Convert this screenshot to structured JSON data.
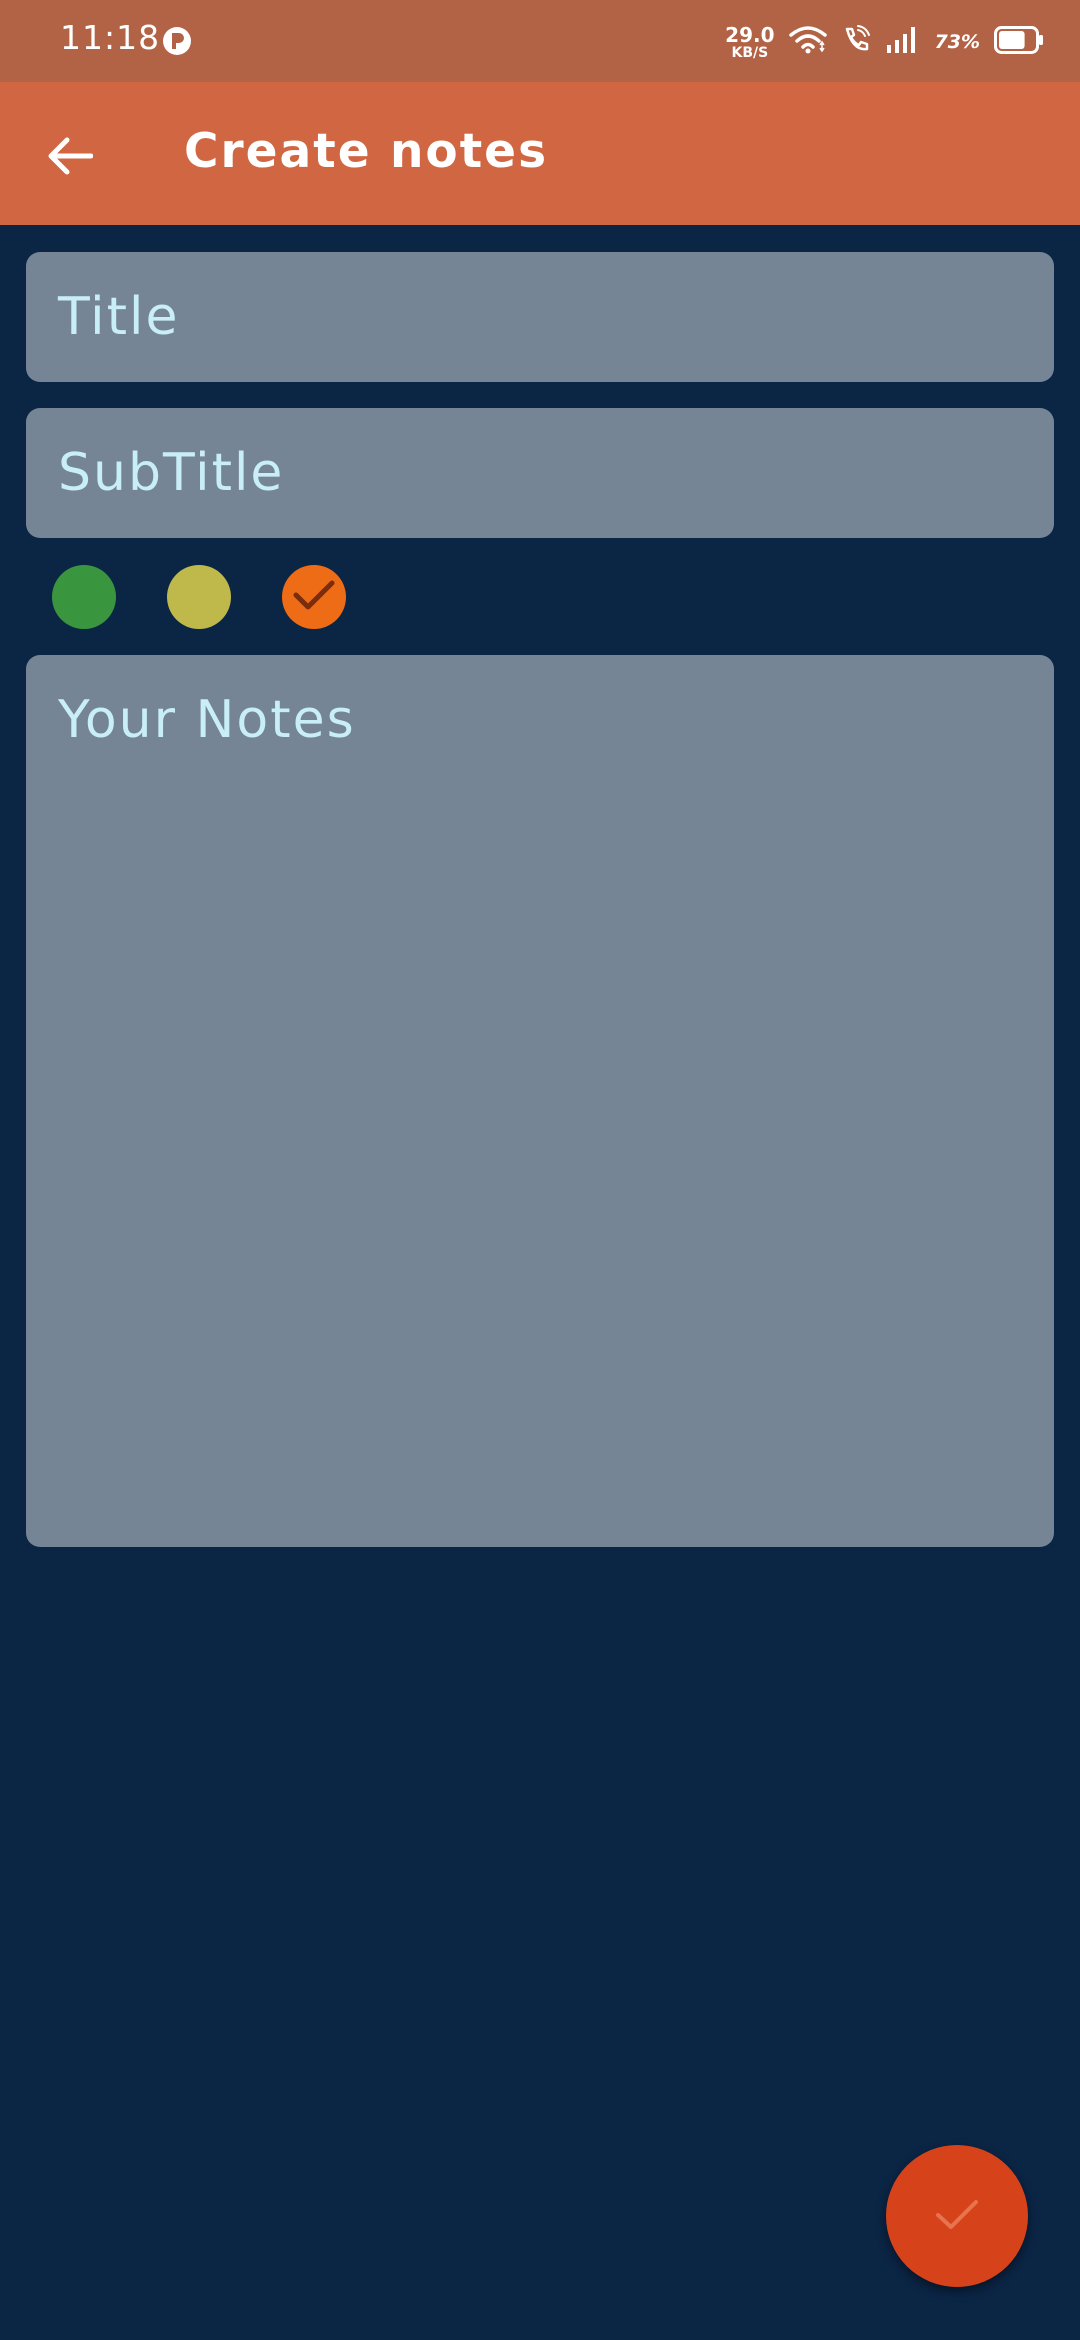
{
  "status_bar": {
    "time": "11:18",
    "net_speed_value": "29.0",
    "net_speed_unit": "KB/S",
    "battery_percent": "73%",
    "battery_level": 0.73
  },
  "app_bar": {
    "title": "Create notes",
    "back_icon": "arrow-left-icon"
  },
  "form": {
    "title_placeholder": "Title",
    "subtitle_placeholder": "SubTitle",
    "notes_placeholder": "Your Notes"
  },
  "color_options": [
    {
      "name": "green",
      "color": "#3a963e",
      "selected": false
    },
    {
      "name": "yellow",
      "color": "#bfb94b",
      "selected": false
    },
    {
      "name": "orange",
      "color": "#ee6c16",
      "selected": true
    }
  ],
  "fab": {
    "icon": "check-icon",
    "color": "#d6431b"
  },
  "colors": {
    "status_bar": "#b26245",
    "app_bar": "#d06642",
    "background": "#0b2545",
    "field_background": "#768596",
    "placeholder_text": "#c8eef7"
  }
}
